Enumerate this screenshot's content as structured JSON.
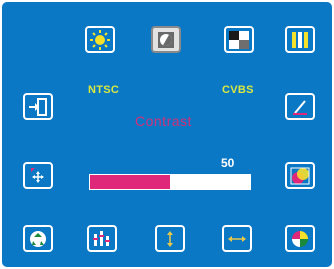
{
  "osd": {
    "standard": "NTSC",
    "source": "CVBS",
    "selected_item": "Contrast",
    "value_text": "50",
    "value_fraction": 0.5,
    "colors": {
      "background": "#0b78c6",
      "bar_fill": "#e0287a",
      "bar_empty": "#ffffff",
      "title": "#d1307a",
      "label": "#d8e842"
    }
  },
  "icons": {
    "top": [
      "brightness-icon",
      "contrast-icon",
      "color-icon",
      "tint-icon",
      "sharpness-icon"
    ],
    "left": [
      "source-input-icon",
      "position-icon"
    ],
    "right": [
      "edit-icon",
      "color-balance-icon"
    ],
    "bottom": [
      "recycle-reset-icon",
      "equalizer-icon",
      "vertical-size-icon",
      "horizontal-size-icon",
      "palette-icon"
    ]
  }
}
